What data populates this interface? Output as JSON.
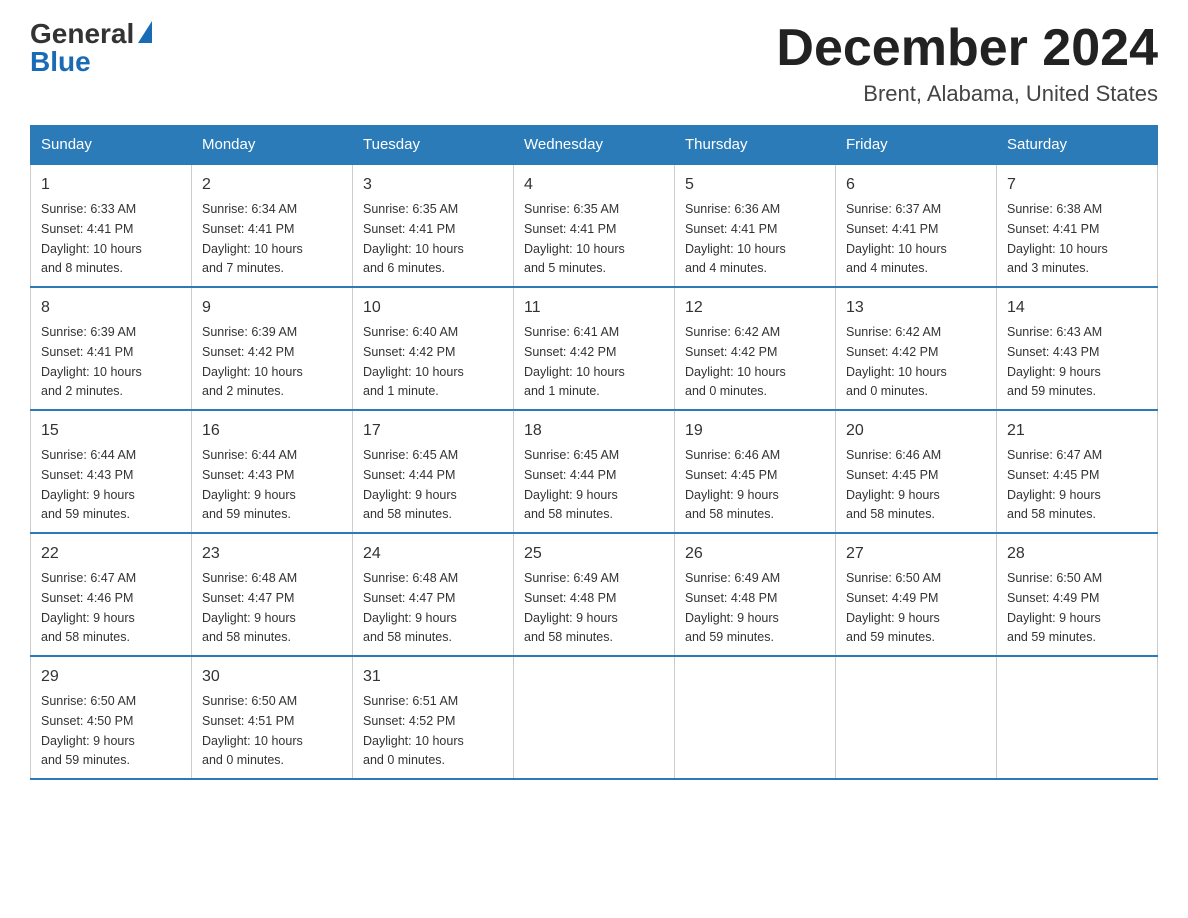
{
  "logo": {
    "general": "General",
    "blue": "Blue"
  },
  "title": "December 2024",
  "subtitle": "Brent, Alabama, United States",
  "days_of_week": [
    "Sunday",
    "Monday",
    "Tuesday",
    "Wednesday",
    "Thursday",
    "Friday",
    "Saturday"
  ],
  "weeks": [
    [
      {
        "day": "1",
        "info": "Sunrise: 6:33 AM\nSunset: 4:41 PM\nDaylight: 10 hours\nand 8 minutes."
      },
      {
        "day": "2",
        "info": "Sunrise: 6:34 AM\nSunset: 4:41 PM\nDaylight: 10 hours\nand 7 minutes."
      },
      {
        "day": "3",
        "info": "Sunrise: 6:35 AM\nSunset: 4:41 PM\nDaylight: 10 hours\nand 6 minutes."
      },
      {
        "day": "4",
        "info": "Sunrise: 6:35 AM\nSunset: 4:41 PM\nDaylight: 10 hours\nand 5 minutes."
      },
      {
        "day": "5",
        "info": "Sunrise: 6:36 AM\nSunset: 4:41 PM\nDaylight: 10 hours\nand 4 minutes."
      },
      {
        "day": "6",
        "info": "Sunrise: 6:37 AM\nSunset: 4:41 PM\nDaylight: 10 hours\nand 4 minutes."
      },
      {
        "day": "7",
        "info": "Sunrise: 6:38 AM\nSunset: 4:41 PM\nDaylight: 10 hours\nand 3 minutes."
      }
    ],
    [
      {
        "day": "8",
        "info": "Sunrise: 6:39 AM\nSunset: 4:41 PM\nDaylight: 10 hours\nand 2 minutes."
      },
      {
        "day": "9",
        "info": "Sunrise: 6:39 AM\nSunset: 4:42 PM\nDaylight: 10 hours\nand 2 minutes."
      },
      {
        "day": "10",
        "info": "Sunrise: 6:40 AM\nSunset: 4:42 PM\nDaylight: 10 hours\nand 1 minute."
      },
      {
        "day": "11",
        "info": "Sunrise: 6:41 AM\nSunset: 4:42 PM\nDaylight: 10 hours\nand 1 minute."
      },
      {
        "day": "12",
        "info": "Sunrise: 6:42 AM\nSunset: 4:42 PM\nDaylight: 10 hours\nand 0 minutes."
      },
      {
        "day": "13",
        "info": "Sunrise: 6:42 AM\nSunset: 4:42 PM\nDaylight: 10 hours\nand 0 minutes."
      },
      {
        "day": "14",
        "info": "Sunrise: 6:43 AM\nSunset: 4:43 PM\nDaylight: 9 hours\nand 59 minutes."
      }
    ],
    [
      {
        "day": "15",
        "info": "Sunrise: 6:44 AM\nSunset: 4:43 PM\nDaylight: 9 hours\nand 59 minutes."
      },
      {
        "day": "16",
        "info": "Sunrise: 6:44 AM\nSunset: 4:43 PM\nDaylight: 9 hours\nand 59 minutes."
      },
      {
        "day": "17",
        "info": "Sunrise: 6:45 AM\nSunset: 4:44 PM\nDaylight: 9 hours\nand 58 minutes."
      },
      {
        "day": "18",
        "info": "Sunrise: 6:45 AM\nSunset: 4:44 PM\nDaylight: 9 hours\nand 58 minutes."
      },
      {
        "day": "19",
        "info": "Sunrise: 6:46 AM\nSunset: 4:45 PM\nDaylight: 9 hours\nand 58 minutes."
      },
      {
        "day": "20",
        "info": "Sunrise: 6:46 AM\nSunset: 4:45 PM\nDaylight: 9 hours\nand 58 minutes."
      },
      {
        "day": "21",
        "info": "Sunrise: 6:47 AM\nSunset: 4:45 PM\nDaylight: 9 hours\nand 58 minutes."
      }
    ],
    [
      {
        "day": "22",
        "info": "Sunrise: 6:47 AM\nSunset: 4:46 PM\nDaylight: 9 hours\nand 58 minutes."
      },
      {
        "day": "23",
        "info": "Sunrise: 6:48 AM\nSunset: 4:47 PM\nDaylight: 9 hours\nand 58 minutes."
      },
      {
        "day": "24",
        "info": "Sunrise: 6:48 AM\nSunset: 4:47 PM\nDaylight: 9 hours\nand 58 minutes."
      },
      {
        "day": "25",
        "info": "Sunrise: 6:49 AM\nSunset: 4:48 PM\nDaylight: 9 hours\nand 58 minutes."
      },
      {
        "day": "26",
        "info": "Sunrise: 6:49 AM\nSunset: 4:48 PM\nDaylight: 9 hours\nand 59 minutes."
      },
      {
        "day": "27",
        "info": "Sunrise: 6:50 AM\nSunset: 4:49 PM\nDaylight: 9 hours\nand 59 minutes."
      },
      {
        "day": "28",
        "info": "Sunrise: 6:50 AM\nSunset: 4:49 PM\nDaylight: 9 hours\nand 59 minutes."
      }
    ],
    [
      {
        "day": "29",
        "info": "Sunrise: 6:50 AM\nSunset: 4:50 PM\nDaylight: 9 hours\nand 59 minutes."
      },
      {
        "day": "30",
        "info": "Sunrise: 6:50 AM\nSunset: 4:51 PM\nDaylight: 10 hours\nand 0 minutes."
      },
      {
        "day": "31",
        "info": "Sunrise: 6:51 AM\nSunset: 4:52 PM\nDaylight: 10 hours\nand 0 minutes."
      },
      {
        "day": "",
        "info": ""
      },
      {
        "day": "",
        "info": ""
      },
      {
        "day": "",
        "info": ""
      },
      {
        "day": "",
        "info": ""
      }
    ]
  ]
}
